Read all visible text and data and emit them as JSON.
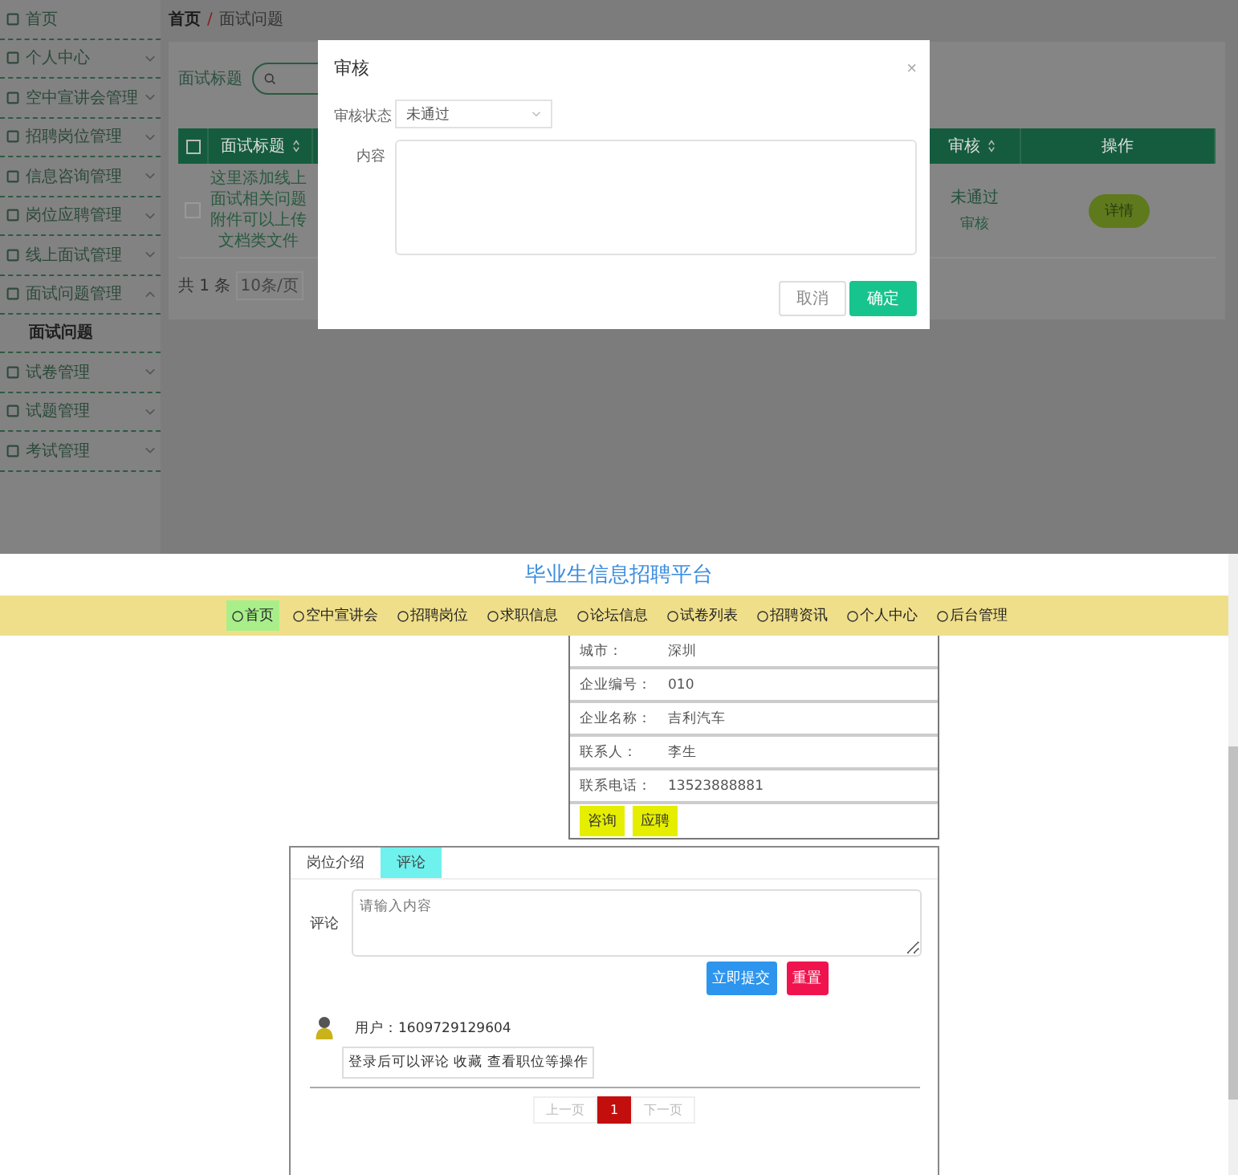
{
  "admin": {
    "sidebar": {
      "items": [
        {
          "label": "首页"
        },
        {
          "label": "个人中心",
          "expanded": false
        },
        {
          "label": "空中宣讲会管理",
          "expanded": false
        },
        {
          "label": "招聘岗位管理",
          "expanded": false
        },
        {
          "label": "信息咨询管理",
          "expanded": false
        },
        {
          "label": "岗位应聘管理",
          "expanded": false
        },
        {
          "label": "线上面试管理",
          "expanded": false
        },
        {
          "label": "面试问题管理",
          "expanded": true,
          "children": [
            {
              "label": "面试问题"
            }
          ]
        },
        {
          "label": "试卷管理",
          "expanded": false
        },
        {
          "label": "试题管理",
          "expanded": false
        },
        {
          "label": "考试管理",
          "expanded": false
        }
      ]
    },
    "breadcrumb": {
      "items": [
        "首页",
        "面试问题"
      ],
      "separator": "/"
    },
    "search": {
      "label": "面试标题"
    },
    "table": {
      "columns": [
        {
          "kind": "checkbox",
          "checked": false
        },
        {
          "label": "面试标题",
          "sortable": true
        },
        {
          "label": "审核",
          "sortable": true
        },
        {
          "label": "操作"
        }
      ],
      "rows": [
        {
          "checked": false,
          "title": "这里添加线上面试相关问题附件可以上传文档类文件",
          "status": "未通过",
          "review_link": "审核",
          "action": "详情"
        }
      ]
    },
    "pagination": {
      "total": "共 1 条",
      "page_size": "10条/页"
    }
  },
  "dialog": {
    "title": "审核",
    "close": "×",
    "fields": [
      {
        "kind": "select",
        "label": "审核状态",
        "value": "未通过"
      },
      {
        "kind": "textarea",
        "label": "内容"
      }
    ],
    "buttons": [
      {
        "kind": "secondary",
        "label": "取消"
      },
      {
        "kind": "primary",
        "label": "确定"
      }
    ]
  },
  "site": {
    "title": "毕业生信息招聘平台",
    "nav": [
      {
        "label": "首页",
        "selected": true
      },
      {
        "label": "空中宣讲会",
        "selected": false
      },
      {
        "label": "招聘岗位",
        "selected": false
      },
      {
        "label": "求职信息",
        "selected": false
      },
      {
        "label": "论坛信息",
        "selected": false
      },
      {
        "label": "试卷列表",
        "selected": false
      },
      {
        "label": "招聘资讯",
        "selected": false
      },
      {
        "label": "个人中心",
        "selected": false
      },
      {
        "label": "后台管理",
        "selected": false
      }
    ],
    "details": [
      {
        "label": "城市：",
        "value": "深圳"
      },
      {
        "label": "企业编号：",
        "value": "010"
      },
      {
        "label": "企业名称：",
        "value": "吉利汽车"
      },
      {
        "label": "联系人：",
        "value": "李生"
      },
      {
        "label": "联系电话：",
        "value": "13523888881"
      }
    ],
    "detail_buttons": [
      "咨询",
      "应聘"
    ],
    "tabs": [
      {
        "label": "岗位介绍",
        "selected": false
      },
      {
        "label": "评论",
        "selected": true
      }
    ],
    "comment_form": {
      "label": "评论",
      "placeholder": "请输入内容",
      "buttons": [
        {
          "kind": "primary",
          "label": "立即提交"
        },
        {
          "kind": "danger",
          "label": "重置"
        }
      ]
    },
    "comments": [
      {
        "user": "用户：1609729129604",
        "text": "登录后可以评论 收藏 查看职位等操作"
      }
    ],
    "pagination": {
      "prev": "上一页",
      "pages": [
        {
          "label": "1",
          "selected": true
        }
      ],
      "next": "下一页"
    }
  }
}
